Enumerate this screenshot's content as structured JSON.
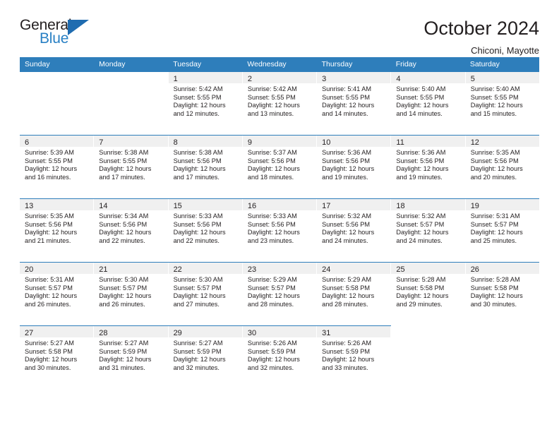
{
  "logo": {
    "word_top": "General",
    "word_bottom": "Blue",
    "triangle_color": "#1f6cb0",
    "blue_color": "#2980c4"
  },
  "header": {
    "title": "October 2024",
    "subtitle": "Chiconi, Mayotte"
  },
  "theme": {
    "header_blue": "#2e7ebb",
    "band_gray": "#f0f0f0",
    "text": "#231f20"
  },
  "weekdays": [
    "Sunday",
    "Monday",
    "Tuesday",
    "Wednesday",
    "Thursday",
    "Friday",
    "Saturday"
  ],
  "weeks": [
    [
      {
        "day": "",
        "sunrise": "",
        "sunset": "",
        "daylight1": "",
        "daylight2": ""
      },
      {
        "day": "",
        "sunrise": "",
        "sunset": "",
        "daylight1": "",
        "daylight2": ""
      },
      {
        "day": "1",
        "sunrise": "Sunrise: 5:42 AM",
        "sunset": "Sunset: 5:55 PM",
        "daylight1": "Daylight: 12 hours",
        "daylight2": "and 12 minutes."
      },
      {
        "day": "2",
        "sunrise": "Sunrise: 5:42 AM",
        "sunset": "Sunset: 5:55 PM",
        "daylight1": "Daylight: 12 hours",
        "daylight2": "and 13 minutes."
      },
      {
        "day": "3",
        "sunrise": "Sunrise: 5:41 AM",
        "sunset": "Sunset: 5:55 PM",
        "daylight1": "Daylight: 12 hours",
        "daylight2": "and 14 minutes."
      },
      {
        "day": "4",
        "sunrise": "Sunrise: 5:40 AM",
        "sunset": "Sunset: 5:55 PM",
        "daylight1": "Daylight: 12 hours",
        "daylight2": "and 14 minutes."
      },
      {
        "day": "5",
        "sunrise": "Sunrise: 5:40 AM",
        "sunset": "Sunset: 5:55 PM",
        "daylight1": "Daylight: 12 hours",
        "daylight2": "and 15 minutes."
      }
    ],
    [
      {
        "day": "6",
        "sunrise": "Sunrise: 5:39 AM",
        "sunset": "Sunset: 5:55 PM",
        "daylight1": "Daylight: 12 hours",
        "daylight2": "and 16 minutes."
      },
      {
        "day": "7",
        "sunrise": "Sunrise: 5:38 AM",
        "sunset": "Sunset: 5:55 PM",
        "daylight1": "Daylight: 12 hours",
        "daylight2": "and 17 minutes."
      },
      {
        "day": "8",
        "sunrise": "Sunrise: 5:38 AM",
        "sunset": "Sunset: 5:56 PM",
        "daylight1": "Daylight: 12 hours",
        "daylight2": "and 17 minutes."
      },
      {
        "day": "9",
        "sunrise": "Sunrise: 5:37 AM",
        "sunset": "Sunset: 5:56 PM",
        "daylight1": "Daylight: 12 hours",
        "daylight2": "and 18 minutes."
      },
      {
        "day": "10",
        "sunrise": "Sunrise: 5:36 AM",
        "sunset": "Sunset: 5:56 PM",
        "daylight1": "Daylight: 12 hours",
        "daylight2": "and 19 minutes."
      },
      {
        "day": "11",
        "sunrise": "Sunrise: 5:36 AM",
        "sunset": "Sunset: 5:56 PM",
        "daylight1": "Daylight: 12 hours",
        "daylight2": "and 19 minutes."
      },
      {
        "day": "12",
        "sunrise": "Sunrise: 5:35 AM",
        "sunset": "Sunset: 5:56 PM",
        "daylight1": "Daylight: 12 hours",
        "daylight2": "and 20 minutes."
      }
    ],
    [
      {
        "day": "13",
        "sunrise": "Sunrise: 5:35 AM",
        "sunset": "Sunset: 5:56 PM",
        "daylight1": "Daylight: 12 hours",
        "daylight2": "and 21 minutes."
      },
      {
        "day": "14",
        "sunrise": "Sunrise: 5:34 AM",
        "sunset": "Sunset: 5:56 PM",
        "daylight1": "Daylight: 12 hours",
        "daylight2": "and 22 minutes."
      },
      {
        "day": "15",
        "sunrise": "Sunrise: 5:33 AM",
        "sunset": "Sunset: 5:56 PM",
        "daylight1": "Daylight: 12 hours",
        "daylight2": "and 22 minutes."
      },
      {
        "day": "16",
        "sunrise": "Sunrise: 5:33 AM",
        "sunset": "Sunset: 5:56 PM",
        "daylight1": "Daylight: 12 hours",
        "daylight2": "and 23 minutes."
      },
      {
        "day": "17",
        "sunrise": "Sunrise: 5:32 AM",
        "sunset": "Sunset: 5:56 PM",
        "daylight1": "Daylight: 12 hours",
        "daylight2": "and 24 minutes."
      },
      {
        "day": "18",
        "sunrise": "Sunrise: 5:32 AM",
        "sunset": "Sunset: 5:57 PM",
        "daylight1": "Daylight: 12 hours",
        "daylight2": "and 24 minutes."
      },
      {
        "day": "19",
        "sunrise": "Sunrise: 5:31 AM",
        "sunset": "Sunset: 5:57 PM",
        "daylight1": "Daylight: 12 hours",
        "daylight2": "and 25 minutes."
      }
    ],
    [
      {
        "day": "20",
        "sunrise": "Sunrise: 5:31 AM",
        "sunset": "Sunset: 5:57 PM",
        "daylight1": "Daylight: 12 hours",
        "daylight2": "and 26 minutes."
      },
      {
        "day": "21",
        "sunrise": "Sunrise: 5:30 AM",
        "sunset": "Sunset: 5:57 PM",
        "daylight1": "Daylight: 12 hours",
        "daylight2": "and 26 minutes."
      },
      {
        "day": "22",
        "sunrise": "Sunrise: 5:30 AM",
        "sunset": "Sunset: 5:57 PM",
        "daylight1": "Daylight: 12 hours",
        "daylight2": "and 27 minutes."
      },
      {
        "day": "23",
        "sunrise": "Sunrise: 5:29 AM",
        "sunset": "Sunset: 5:57 PM",
        "daylight1": "Daylight: 12 hours",
        "daylight2": "and 28 minutes."
      },
      {
        "day": "24",
        "sunrise": "Sunrise: 5:29 AM",
        "sunset": "Sunset: 5:58 PM",
        "daylight1": "Daylight: 12 hours",
        "daylight2": "and 28 minutes."
      },
      {
        "day": "25",
        "sunrise": "Sunrise: 5:28 AM",
        "sunset": "Sunset: 5:58 PM",
        "daylight1": "Daylight: 12 hours",
        "daylight2": "and 29 minutes."
      },
      {
        "day": "26",
        "sunrise": "Sunrise: 5:28 AM",
        "sunset": "Sunset: 5:58 PM",
        "daylight1": "Daylight: 12 hours",
        "daylight2": "and 30 minutes."
      }
    ],
    [
      {
        "day": "27",
        "sunrise": "Sunrise: 5:27 AM",
        "sunset": "Sunset: 5:58 PM",
        "daylight1": "Daylight: 12 hours",
        "daylight2": "and 30 minutes."
      },
      {
        "day": "28",
        "sunrise": "Sunrise: 5:27 AM",
        "sunset": "Sunset: 5:59 PM",
        "daylight1": "Daylight: 12 hours",
        "daylight2": "and 31 minutes."
      },
      {
        "day": "29",
        "sunrise": "Sunrise: 5:27 AM",
        "sunset": "Sunset: 5:59 PM",
        "daylight1": "Daylight: 12 hours",
        "daylight2": "and 32 minutes."
      },
      {
        "day": "30",
        "sunrise": "Sunrise: 5:26 AM",
        "sunset": "Sunset: 5:59 PM",
        "daylight1": "Daylight: 12 hours",
        "daylight2": "and 32 minutes."
      },
      {
        "day": "31",
        "sunrise": "Sunrise: 5:26 AM",
        "sunset": "Sunset: 5:59 PM",
        "daylight1": "Daylight: 12 hours",
        "daylight2": "and 33 minutes."
      },
      {
        "day": "",
        "sunrise": "",
        "sunset": "",
        "daylight1": "",
        "daylight2": ""
      },
      {
        "day": "",
        "sunrise": "",
        "sunset": "",
        "daylight1": "",
        "daylight2": ""
      }
    ]
  ]
}
